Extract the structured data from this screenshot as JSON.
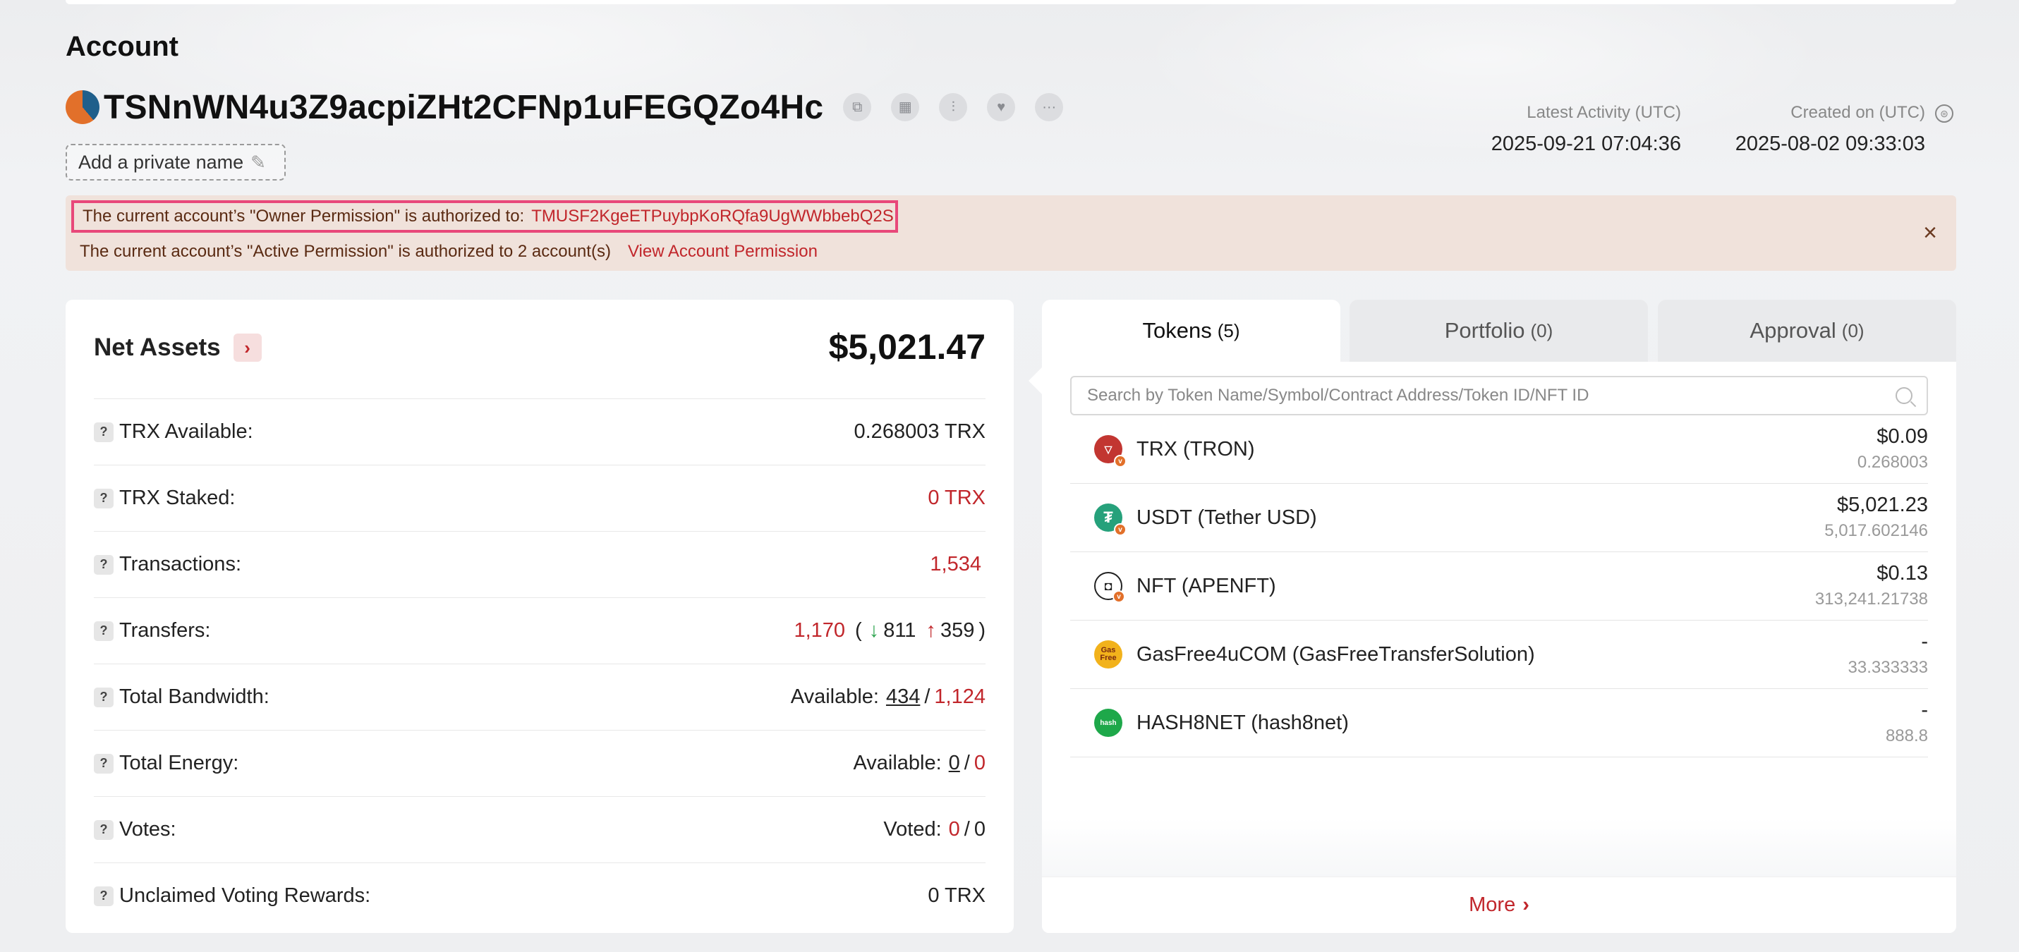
{
  "page": {
    "heading": "Account"
  },
  "account": {
    "address": "TSNnWN4u3Z9acpiZHt2CFNp1uFEGQZo4Hc",
    "private_name_label": "Add a private name",
    "latest_activity_label": "Latest Activity (UTC)",
    "latest_activity_value": "2025-09-21 07:04:36",
    "created_label": "Created on (UTC)",
    "created_value": "2025-08-02 09:33:03"
  },
  "alert": {
    "owner_text": "The current account’s \"Owner Permission\" is authorized to:",
    "owner_address": "TMUSF2KgeETPuybpKoRQfa9UgWWbbebQ2S",
    "active_text": "The current account’s \"Active Permission\" is authorized to 2 account(s)",
    "active_link": "View Account Permission"
  },
  "net_assets": {
    "title": "Net Assets",
    "value": "$5,021.47",
    "trx_available_label": "TRX Available:",
    "trx_available_value": "0.268003 TRX",
    "trx_staked_label": "TRX Staked:",
    "trx_staked_value": "0 TRX",
    "transactions_label": "Transactions:",
    "transactions_value": "1,534",
    "transfers_label": "Transfers:",
    "transfers_total": "1,170",
    "transfers_in": "811",
    "transfers_out": "359",
    "bandwidth_label": "Total Bandwidth:",
    "bandwidth_prefix": "Available:",
    "bandwidth_available": "434",
    "bandwidth_total": "1,124",
    "energy_label": "Total Energy:",
    "energy_prefix": "Available:",
    "energy_available": "0",
    "energy_total": "0",
    "votes_label": "Votes:",
    "votes_prefix": "Voted:",
    "votes_voted": "0",
    "votes_total": "0",
    "rewards_label": "Unclaimed Voting Rewards:",
    "rewards_value": "0 TRX"
  },
  "tabs": [
    {
      "label": "Tokens",
      "count": "(5)"
    },
    {
      "label": "Portfolio",
      "count": "(0)"
    },
    {
      "label": "Approval",
      "count": "(0)"
    }
  ],
  "search": {
    "placeholder": "Search by Token Name/Symbol/Contract Address/Token ID/NFT ID"
  },
  "tokens": [
    {
      "name": "TRX (TRON)",
      "usd": "$0.09",
      "amount": "0.268003",
      "icon": "tron-icon",
      "color": "#c23631"
    },
    {
      "name": "USDT (Tether USD)",
      "usd": "$5,021.23",
      "amount": "5,017.602146",
      "icon": "tether-icon",
      "color": "#26a17b"
    },
    {
      "name": "NFT (APENFT)",
      "usd": "$0.13",
      "amount": "313,241.21738",
      "icon": "apenft-icon",
      "color": "#222222"
    },
    {
      "name": "GasFree4uCOM (GasFreeTransferSolution)",
      "usd": "-",
      "amount": "33.333333",
      "icon": "gasfree-icon",
      "color": "#f2b21b"
    },
    {
      "name": "HASH8NET (hash8net)",
      "usd": "-",
      "amount": "888.8",
      "icon": "hash8net-icon",
      "color": "#1ea84a"
    }
  ],
  "more_label": "More",
  "icon_glyphs": {
    "gasfree": "Gas Free",
    "hash8net": "hash",
    "verified": "v"
  }
}
